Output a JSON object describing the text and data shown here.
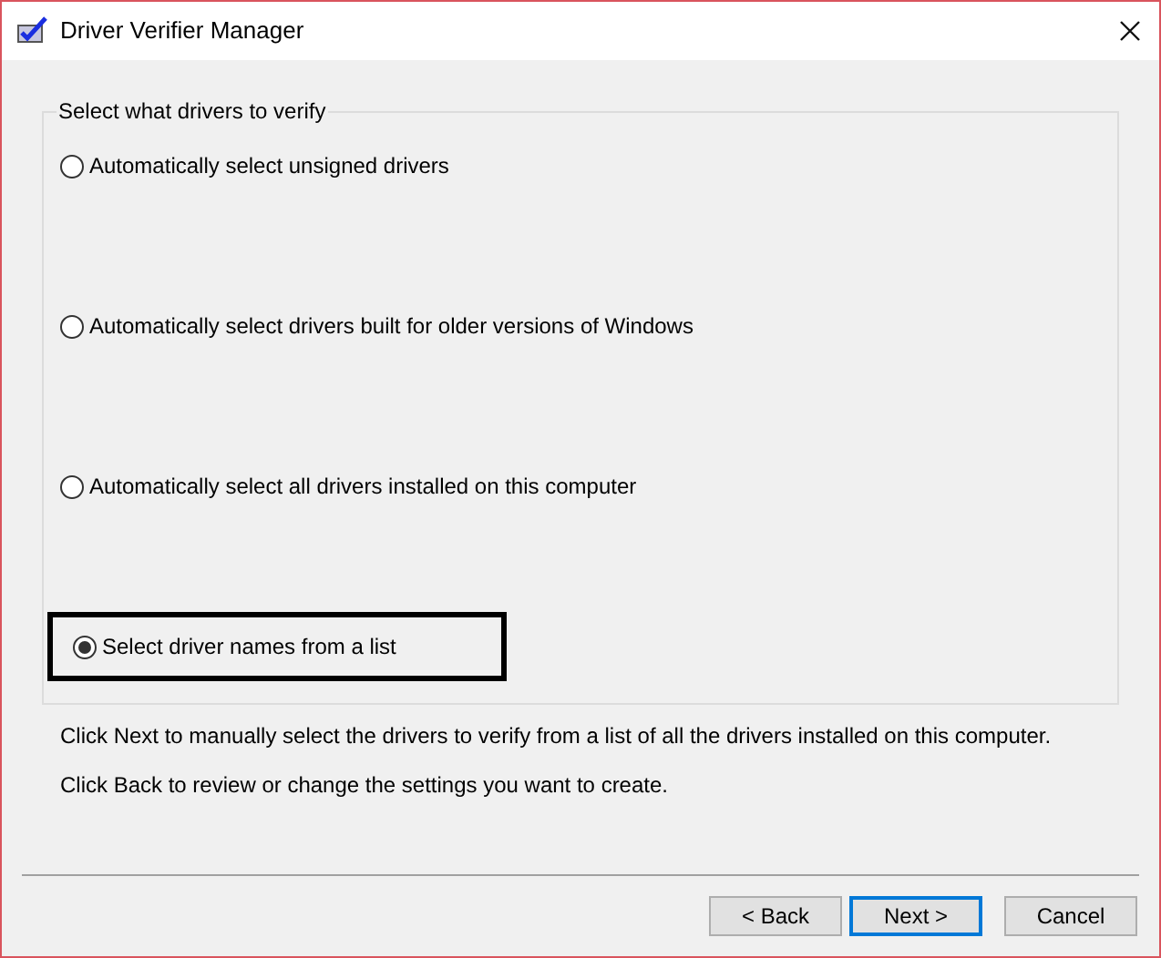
{
  "window": {
    "title": "Driver Verifier Manager"
  },
  "group": {
    "title": "Select what drivers to verify",
    "options": [
      {
        "label": "Automatically select unsigned drivers",
        "selected": false,
        "highlighted": false
      },
      {
        "label": "Automatically select drivers built for older versions of Windows",
        "selected": false,
        "highlighted": false
      },
      {
        "label": "Automatically select all drivers installed on this computer",
        "selected": false,
        "highlighted": false
      },
      {
        "label": "Select driver names from a list",
        "selected": true,
        "highlighted": true
      }
    ]
  },
  "instructions": [
    "Click Next to manually select the drivers to verify from a list of all the drivers installed on this computer.",
    "Click Back to review or change the settings you want to create."
  ],
  "buttons": [
    {
      "label": "< Back",
      "default": false
    },
    {
      "label": "Next >",
      "default": true
    },
    {
      "label": "Cancel",
      "default": false
    }
  ]
}
